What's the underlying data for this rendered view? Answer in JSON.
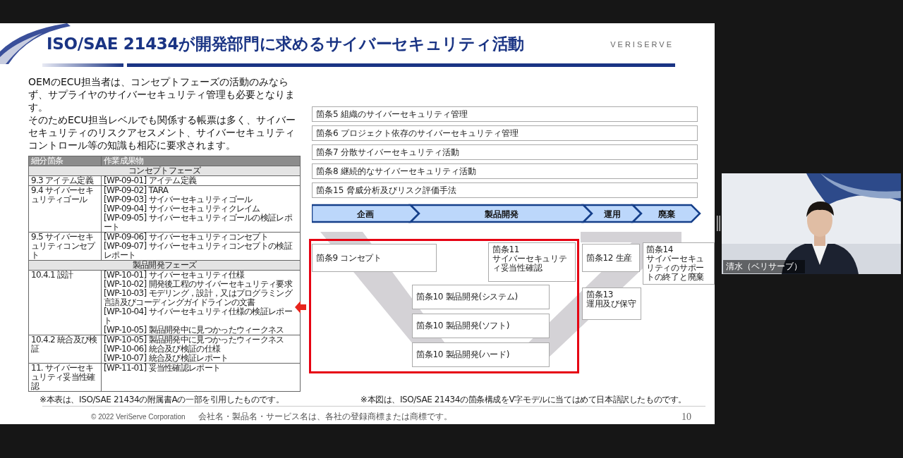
{
  "slide": {
    "title": "ISO/SAE 21434が開発部門に求めるサイバーセキュリティ活動",
    "brand": "VERISERVE",
    "intro": [
      "OEMのECU担当者は、コンセプトフェーズの活動のみならず、サプライヤのサイバーセキュリティ管理も必要となります。",
      "そのためECU担当レベルでも関係する帳票は多く、サイバーセキュリティのリスクアセスメント、サイバーセキュリティコントロール等の知識も相応に要求されます。"
    ],
    "table": {
      "columns": [
        "細分箇条",
        "作業成果物"
      ],
      "rows": [
        {
          "kind": "phase",
          "label": "コンセプトフェーズ"
        },
        {
          "kind": "item",
          "clause": "9.3 アイテム定義",
          "products": [
            "[WP-09-01] アイテム定義"
          ]
        },
        {
          "kind": "item",
          "clause": "9.4 サイバーセキュリティゴール",
          "products": [
            "[WP-09-02] TARA",
            "[WP-09-03] サイバーセキュリティゴール",
            "[WP-09-04] サイバーセキュリティクレイム",
            "[WP-09-05] サイバーセキュリティゴールの検証レポート"
          ]
        },
        {
          "kind": "item",
          "clause": "9.5 サイバーセキュリティコンセプト",
          "products": [
            "[WP-09-06] サイバーセキュリティコンセプト",
            "[WP-09-07] サイバーセキュリティコンセプトの検証レポート"
          ]
        },
        {
          "kind": "phase",
          "label": "製品開発フェーズ"
        },
        {
          "kind": "item",
          "clause": "10.4.1 設計",
          "products": [
            "[WP-10-01] サイバーセキュリティ仕様",
            "[WP-10-02] 開発後工程のサイバーセキュリティ要求",
            "[WP-10-03] モデリング，設計，又はプログラミング言語及びコーディングガイドラインの文書",
            "[WP-10-04] サイバーセキュリティ仕様の検証レポート",
            "[WP-10-05] 製品開発中に見つかったウィークネス"
          ]
        },
        {
          "kind": "item",
          "clause": "10.4.2 統合及び検証",
          "products": [
            "[WP-10-05] 製品開発中に見つかったウィークネス",
            "[WP-10-06] 統合及び検証の仕様",
            "[WP-10-07] 統合及び検証レポート"
          ]
        },
        {
          "kind": "item",
          "clause": "11. サイバーセキュリティ妥当性確認",
          "products": [
            "[WP-11-01] 妥当性確認レポート"
          ]
        }
      ]
    },
    "table_note": "※本表は、ISO/SAE 21434の附属書Aの一部を引用したものです。",
    "clauses": [
      "箇条5  組織のサイバーセキュリティ管理",
      "箇条6  プロジェクト依存のサイバーセキュリティ管理",
      "箇条7  分散サイバーセキュリティ活動",
      "箇条8  継続的なサイバーセキュリティ活動",
      "箇条15  脅威分析及びリスク評価手法"
    ],
    "phases": [
      "企画",
      "製品開発",
      "運用",
      "廃棄"
    ],
    "v_model": [
      "箇条9  コンセプト",
      "箇条11\nサイバーセキュリティ妥当性確認",
      "箇条12  生産",
      "箇条14\nサイバーセキュリティのサポートの終了と廃棄",
      "箇条10  製品開発(システム)",
      "箇条13\n運用及び保守",
      "箇条10  製品開発(ソフト)",
      "箇条10  製品開発(ハード)"
    ],
    "figure_note": "※本図は、ISO/SAE 21434の箇条構成をV字モデルに当てはめて日本語訳したものです。",
    "footer": {
      "copyright": "© 2022 VeriServe Corporation",
      "trademark": "会社名・製品名・サービス名は、各社の登録商標または商標です。",
      "page": "10"
    }
  },
  "video": {
    "participant": "清水（ベリサーブ）"
  }
}
